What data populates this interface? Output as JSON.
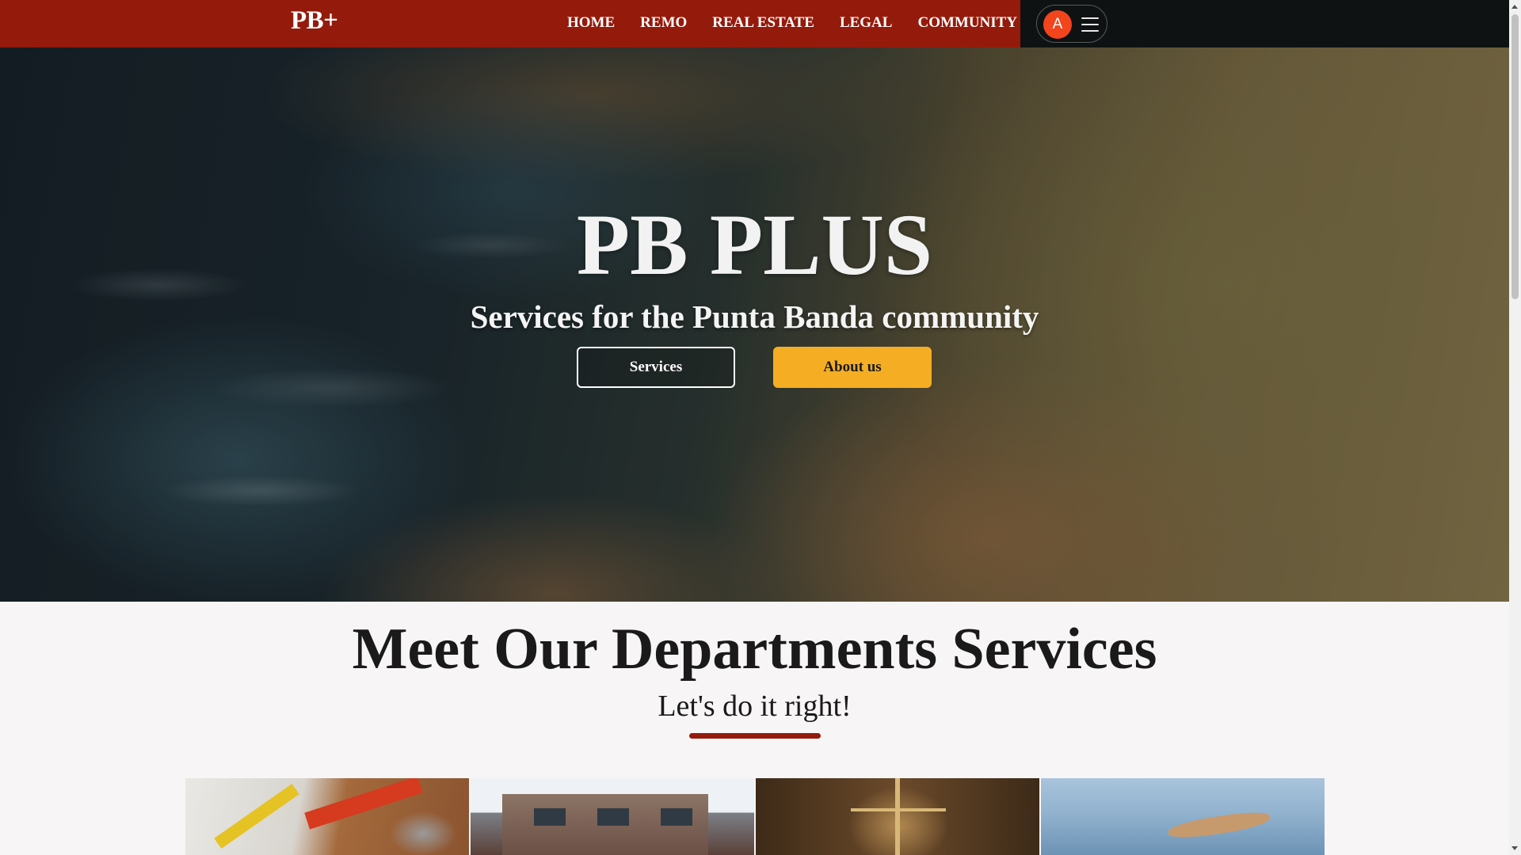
{
  "header": {
    "logo": "PB+",
    "nav": [
      "HOME",
      "REMO",
      "REAL ESTATE",
      "LEGAL",
      "COMMUNITY"
    ],
    "avatar_letter": "A",
    "menu_icon": "hamburger-icon",
    "colors": {
      "brand": "#941b0c",
      "accent": "#f2441d",
      "dark": "#0f1212"
    }
  },
  "hero": {
    "title": "PB PLUS",
    "subtitle": "Services for the Punta Banda community",
    "buttons": {
      "services": "Services",
      "about": "About us"
    },
    "colors": {
      "cta": "#f5ae23"
    }
  },
  "departments": {
    "title": "Meet Our Departments Services",
    "subtitle": "Let's do it right!",
    "cards": [
      "tools-image",
      "house-image",
      "justice-scale-image",
      "island-image"
    ]
  }
}
